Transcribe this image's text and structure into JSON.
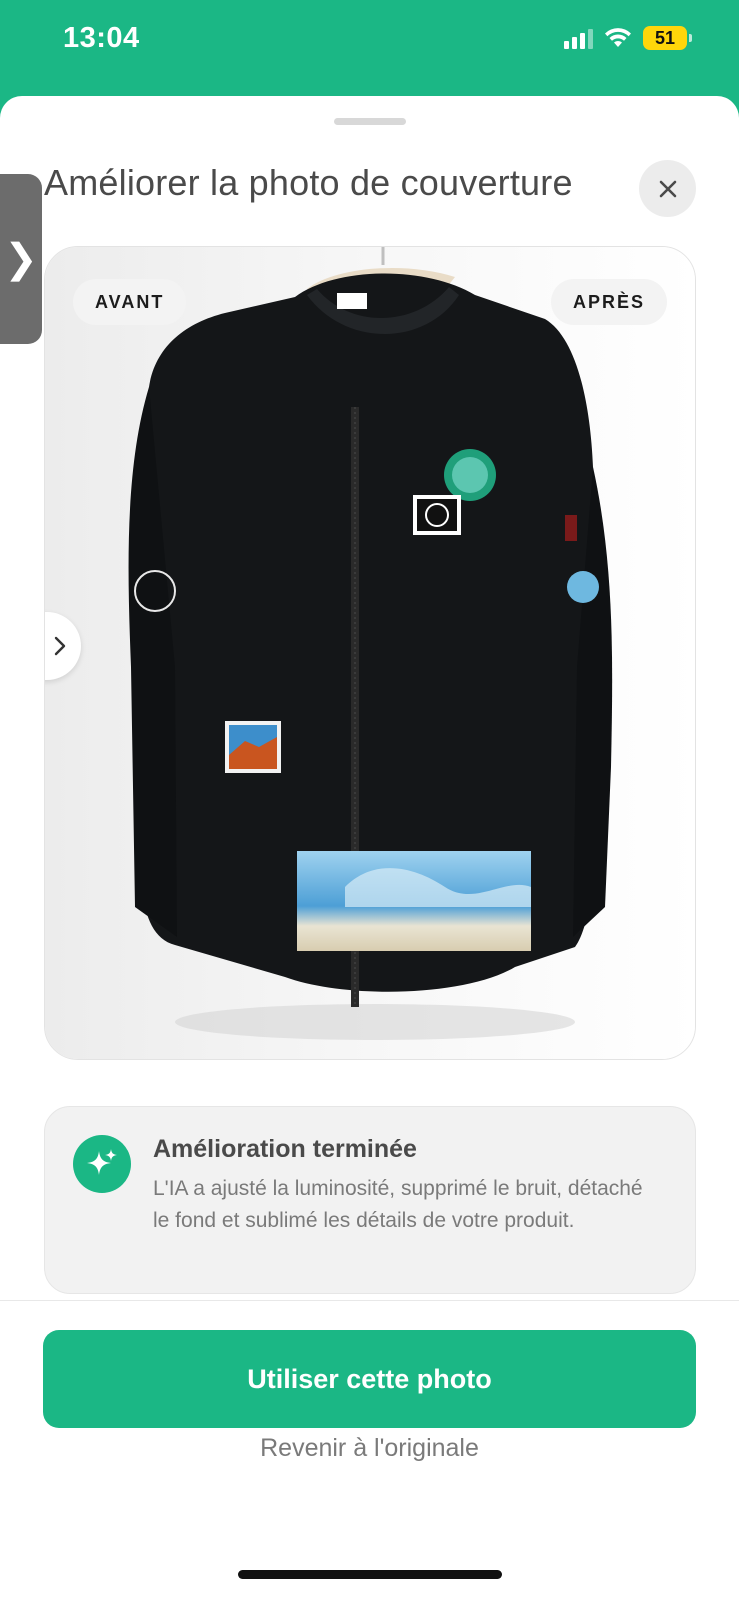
{
  "status_bar": {
    "time": "13:04",
    "battery": "51"
  },
  "sheet": {
    "side_tab_glyph": "❯",
    "title": "Améliorer la photo de couverture"
  },
  "photo": {
    "before_label": "AVANT",
    "after_label": "APRÈS"
  },
  "info": {
    "title": "Amélioration terminée",
    "body": "L'IA a ajusté la luminosité, supprimé le bruit, détaché le fond et sublimé les détails de votre produit."
  },
  "actions": {
    "primary_label": "Utiliser cette photo",
    "secondary_label": "Revenir à l'originale"
  },
  "colors": {
    "accent": "#1bb785",
    "text_dark": "#4a4a4a",
    "text_muted": "#7a7a7a"
  }
}
